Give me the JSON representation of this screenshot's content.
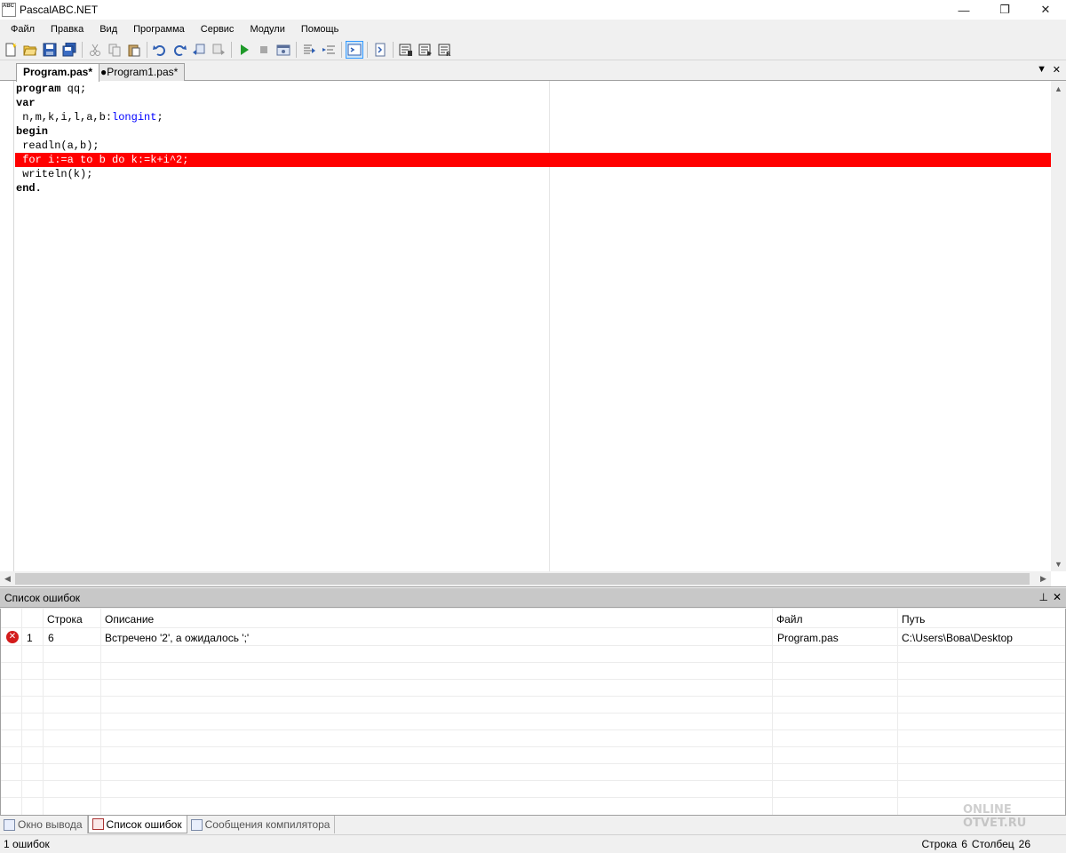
{
  "window": {
    "title": "PascalABC.NET",
    "icon_text": "ABC",
    "minimize": "—",
    "restore": "❐",
    "close": "✕"
  },
  "menu": [
    "Файл",
    "Правка",
    "Вид",
    "Программа",
    "Сервис",
    "Модули",
    "Помощь"
  ],
  "toolbar": {
    "buttons": [
      "new-file-icon",
      "open-folder-icon",
      "save-icon",
      "save-all-icon",
      "cut-icon",
      "copy-icon",
      "paste-icon",
      "undo-icon",
      "redo-icon",
      "navigate-back-icon",
      "navigate-forward-icon",
      "run-icon",
      "stop-icon",
      "debug-window-icon",
      "step-into-icon",
      "step-over-icon",
      "output-window-icon",
      "intellisense-icon",
      "format-icon",
      "compile-icon",
      "rebuild-icon"
    ]
  },
  "tabs": [
    {
      "label": "Program.pas*",
      "active": true
    },
    {
      "label": "●Program1.pas*",
      "active": false
    }
  ],
  "editor": {
    "lines": [
      [
        {
          "t": "program",
          "k": "kw"
        },
        {
          "t": " qq;",
          "k": ""
        }
      ],
      [
        {
          "t": "var",
          "k": "kw"
        }
      ],
      [
        {
          "t": " n,m,k,i,l,a,b:",
          "k": ""
        },
        {
          "t": "longint",
          "k": "type"
        },
        {
          "t": ";",
          "k": ""
        }
      ],
      [
        {
          "t": "begin",
          "k": "kw"
        }
      ],
      [
        {
          "t": " readln(a,b);",
          "k": ""
        }
      ],
      [
        {
          "t": " for i:=a to b do k:=k+i^2;",
          "k": ""
        }
      ],
      [
        {
          "t": " writeln(k);",
          "k": ""
        }
      ],
      [
        {
          "t": "end.",
          "k": "kw"
        }
      ]
    ],
    "error_line_index": 5,
    "error_color": "#ff0000"
  },
  "error_panel": {
    "title": "Список ошибок",
    "pin": "📌",
    "close": "✕",
    "columns": [
      "",
      "Строка",
      "Описание",
      "Файл",
      "Путь"
    ],
    "rows": [
      {
        "num": "1",
        "line": "6",
        "description": "Встречено '2', а ожидалось ';'",
        "file": "Program.pas",
        "path": "C:\\Users\\Вова\\Desktop"
      }
    ]
  },
  "bottom_tabs": [
    {
      "label": "Окно вывода",
      "active": false
    },
    {
      "label": "Список ошибок",
      "active": true
    },
    {
      "label": "Сообщения компилятора",
      "active": false
    }
  ],
  "status": {
    "left": "1 ошибок",
    "row_label": "Строка",
    "row_value": "6",
    "col_label": "Столбец",
    "col_value": "26"
  },
  "watermark": {
    "line1": "ONLINE",
    "line2": "OTVET.RU"
  }
}
